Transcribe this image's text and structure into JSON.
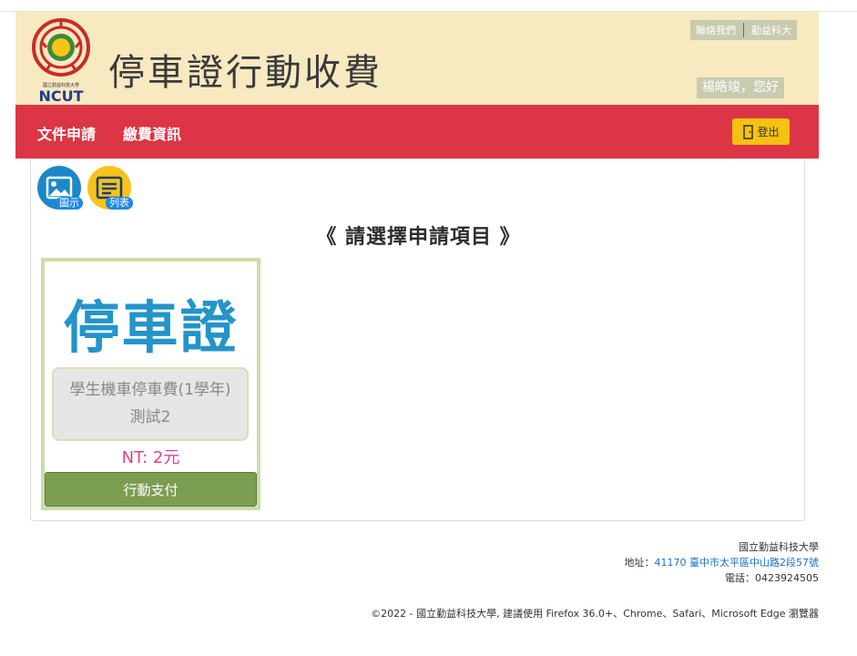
{
  "header": {
    "logo_text": "NCUT",
    "logo_subtitle": "國立勤益科技大學",
    "site_title": "停車證行動收費",
    "top_links": [
      "聯絡我們",
      "勤益科大"
    ],
    "greeting": "楊皓竣，您好"
  },
  "navbar": {
    "items": [
      "文件申請",
      "繳費資訊"
    ],
    "logout_label": "登出",
    "logout_icon": "door-exit-icon"
  },
  "main": {
    "view_buttons": [
      {
        "label": "圖示",
        "icon": "image-icon"
      },
      {
        "label": "列表",
        "icon": "list-icon"
      }
    ],
    "select_title": "《 請選擇申請項目 》",
    "cards": [
      {
        "big_text": "停車證",
        "item_line1": "學生機車停車費(1學年)",
        "item_line2": "測試2",
        "price": "NT: 2元",
        "pay_label": "行動支付"
      }
    ]
  },
  "footer": {
    "school": "國立勤益科技大學",
    "address_label": "地址：",
    "address_value": "41170 臺中市太平區中山路2段57號",
    "phone": "電話：0423924505",
    "copyright": "©2022 - 國立勤益科技大學, 建議使用 Firefox 36.0+、Chrome、Safari、Microsoft Edge 瀏覽器"
  },
  "colors": {
    "header_bg": "#f7e9c0",
    "navbar_bg": "#dc3545",
    "logout_bg": "#f5c211",
    "card_title": "#2494c9",
    "price": "#e83e8c",
    "pay_button": "#7b9e52"
  }
}
